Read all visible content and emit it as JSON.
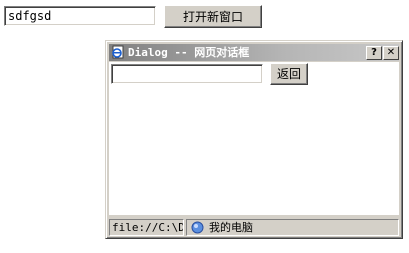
{
  "page": {
    "input_value": "sdfgsd",
    "open_button_label": "打开新窗口"
  },
  "dialog": {
    "title": "Dialog -- 网页对话框",
    "help_label": "?",
    "close_label": "✕",
    "input_value": "",
    "back_button_label": "返回",
    "status": {
      "url": "file://C:\\Do",
      "zone": "我的电脑"
    }
  },
  "colors": {
    "face": "#d4d0c8",
    "titlebar_start": "#808080",
    "titlebar_end": "#c8c8c8"
  }
}
